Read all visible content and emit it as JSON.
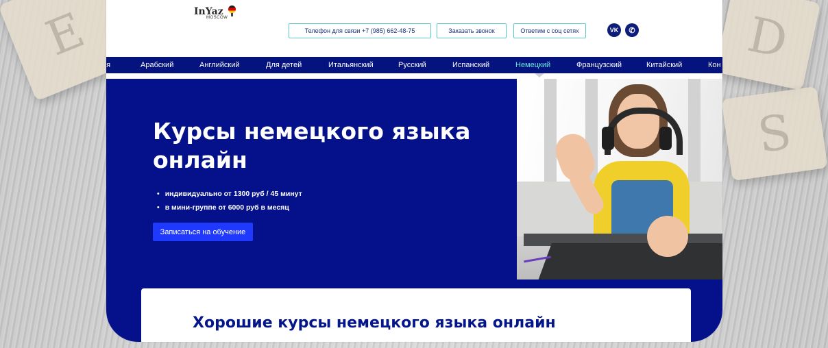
{
  "background": {
    "tiles": [
      "E",
      "D",
      "S"
    ]
  },
  "header": {
    "logo_main": "InYaz",
    "logo_sub": "MOSCOW",
    "phone_button": "Телефон для связи +7 (985) 662-48-75",
    "call_button": "Заказать звонок",
    "social_button": "Ответим с соц сетях",
    "social_icons": [
      {
        "name": "vk-icon",
        "label": "VK"
      },
      {
        "name": "whatsapp-icon",
        "label": "✆"
      }
    ]
  },
  "nav": {
    "items": [
      "ая",
      "Арабский",
      "Английский",
      "Для детей",
      "Итальянский",
      "Русский",
      "Испанский",
      "Немецкий",
      "Французский",
      "Китайский",
      "Кон"
    ],
    "active": "Немецкий"
  },
  "hero": {
    "title": "Курсы немецкого языка онлайн",
    "bullets": [
      "индивидуально от 1300 руб / 45 минут",
      "в мини-группе от 6000 руб в месяц"
    ],
    "cta": "Записаться на обучение"
  },
  "card": {
    "title": "Хорошие курсы немецкого языка онлайн"
  },
  "colors": {
    "navy": "#04137e",
    "hero": "#04118a",
    "accent": "#1f39ff",
    "active_nav": "#6ee3e0",
    "border": "#5cc9c9"
  }
}
